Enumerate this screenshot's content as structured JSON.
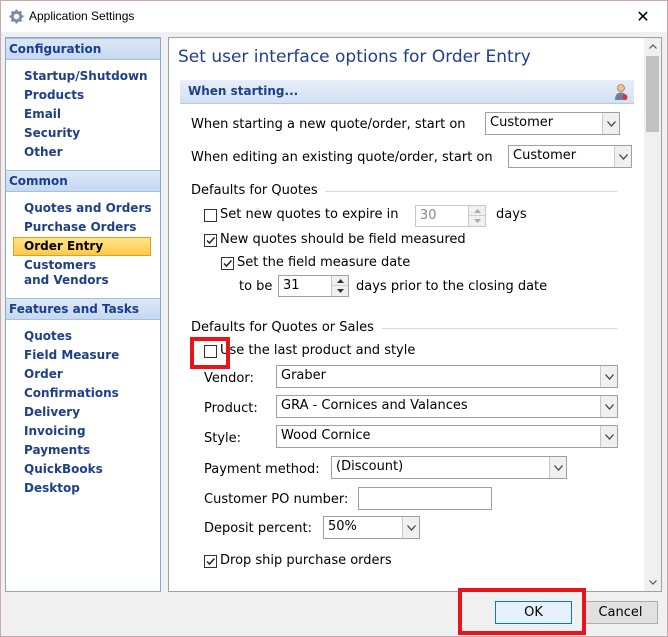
{
  "window": {
    "title": "Application Settings",
    "close_glyph": "✕"
  },
  "sidebar": {
    "sections": [
      {
        "header": "Configuration",
        "items": [
          {
            "label": "Startup/Shutdown"
          },
          {
            "label": "Products"
          },
          {
            "label": "Email"
          },
          {
            "label": "Security"
          },
          {
            "label": "Other"
          }
        ]
      },
      {
        "header": "Common",
        "items": [
          {
            "label": "Quotes and Orders"
          },
          {
            "label": "Purchase Orders"
          },
          {
            "label": "Order Entry",
            "active": true
          },
          {
            "label": "Customers and Vendors"
          }
        ]
      },
      {
        "header": "Features and Tasks",
        "items": [
          {
            "label": "Quotes"
          },
          {
            "label": "Field Measure"
          },
          {
            "label": "Order Confirmations"
          },
          {
            "label": "Delivery"
          },
          {
            "label": "Invoicing"
          },
          {
            "label": "Payments"
          },
          {
            "label": "QuickBooks Desktop"
          }
        ]
      }
    ]
  },
  "main": {
    "title": "Set user interface options for Order Entry",
    "section_header": "When starting...",
    "start_new_label": "When starting a new quote/order, start on",
    "start_new_value": "Customer",
    "edit_existing_label": "When editing an existing quote/order, start on",
    "edit_existing_value": "Customer",
    "quotes_group": {
      "title": "Defaults for Quotes",
      "expire_label": "Set new quotes to expire in",
      "expire_checked": false,
      "expire_value": "30",
      "expire_unit": "days",
      "field_measured_label": "New quotes should be field measured",
      "field_measured_checked": true,
      "measure_date_label": "Set the field measure date",
      "measure_date_checked": true,
      "to_be_label": "to be",
      "to_be_value": "31",
      "days_prior_label": "days prior to the closing date"
    },
    "sales_group": {
      "title": "Defaults for Quotes or Sales",
      "use_last_label": "Use the last product and style",
      "use_last_checked": false,
      "vendor_label": "Vendor:",
      "vendor_value": "Graber",
      "product_label": "Product:",
      "product_value": "GRA - Cornices and Valances",
      "style_label": "Style:",
      "style_value": "Wood Cornice",
      "payment_label": "Payment method:",
      "payment_value": "(Discount)",
      "po_label": "Customer PO number:",
      "po_value": "",
      "deposit_label": "Deposit percent:",
      "deposit_value": "50%",
      "drop_ship_label": "Drop ship purchase orders",
      "drop_ship_checked": true
    }
  },
  "footer": {
    "ok_label": "OK",
    "cancel_label": "Cancel"
  },
  "colors": {
    "accent_blue": "#1e3f8a",
    "highlight_red": "#e8141c",
    "active_item": "#ffc949"
  }
}
